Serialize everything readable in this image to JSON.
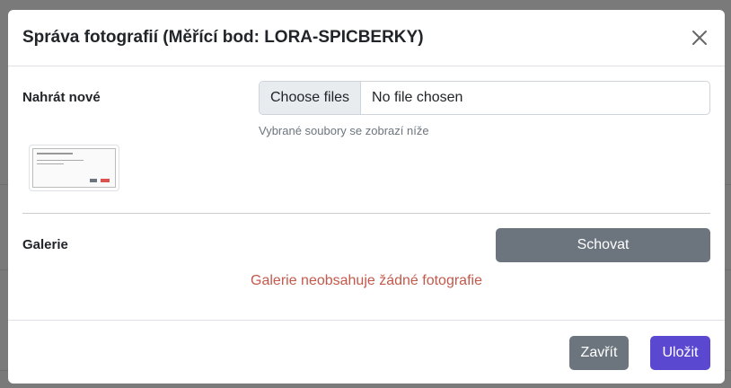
{
  "modal": {
    "title": "Správa fotografií (Měřící bod: LORA-SPICBERKY)",
    "close_icon": "close-icon"
  },
  "upload": {
    "label": "Nahrát nové",
    "choose_button": "Choose files",
    "file_status": "No file chosen",
    "hint": "Vybrané soubory se zobrazí níže"
  },
  "gallery": {
    "label": "Galerie",
    "toggle_button": "Schovat",
    "empty_message": "Galerie neobsahuje žádné fotografie"
  },
  "footer": {
    "close_button": "Zavřít",
    "save_button": "Uložit"
  },
  "colors": {
    "secondary": "#6c757d",
    "primary": "#5b48d1",
    "danger_text": "#c4584a"
  }
}
